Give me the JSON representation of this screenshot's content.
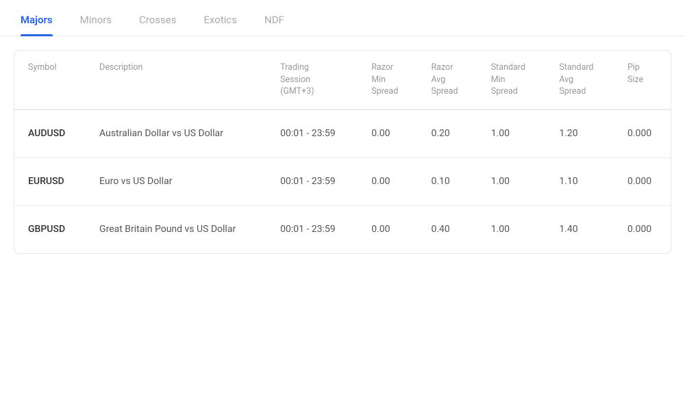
{
  "tabs": [
    {
      "id": "majors",
      "label": "Majors",
      "active": true
    },
    {
      "id": "minors",
      "label": "Minors",
      "active": false
    },
    {
      "id": "crosses",
      "label": "Crosses",
      "active": false
    },
    {
      "id": "exotics",
      "label": "Exotics",
      "active": false
    },
    {
      "id": "ndf",
      "label": "NDF",
      "active": false
    }
  ],
  "table": {
    "columns": [
      {
        "id": "symbol",
        "label": "Symbol"
      },
      {
        "id": "description",
        "label": "Description"
      },
      {
        "id": "trading_session",
        "label": "Trading\nSession\n(GMT+3)"
      },
      {
        "id": "razor_min_spread",
        "label": "Razor\nMin\nSpread"
      },
      {
        "id": "razor_avg_spread",
        "label": "Razor\nAvg\nSpread"
      },
      {
        "id": "standard_min_spread",
        "label": "Standard\nMin\nSpread"
      },
      {
        "id": "standard_avg_spread",
        "label": "Standard\nAvg\nSpread"
      },
      {
        "id": "pip_size",
        "label": "Pip\nSize"
      }
    ],
    "rows": [
      {
        "symbol": "AUDUSD",
        "description": "Australian Dollar vs US Dollar",
        "trading_session": "00:01 - 23:59",
        "razor_min_spread": "0.00",
        "razor_avg_spread": "0.20",
        "standard_min_spread": "1.00",
        "standard_avg_spread": "1.20",
        "pip_size": "0.000"
      },
      {
        "symbol": "EURUSD",
        "description": "Euro vs US Dollar",
        "trading_session": "00:01 - 23:59",
        "razor_min_spread": "0.00",
        "razor_avg_spread": "0.10",
        "standard_min_spread": "1.00",
        "standard_avg_spread": "1.10",
        "pip_size": "0.000"
      },
      {
        "symbol": "GBPUSD",
        "description": "Great Britain Pound vs US Dollar",
        "trading_session": "00:01 - 23:59",
        "razor_min_spread": "0.00",
        "razor_avg_spread": "0.40",
        "standard_min_spread": "1.00",
        "standard_avg_spread": "1.40",
        "pip_size": "0.000"
      }
    ]
  }
}
